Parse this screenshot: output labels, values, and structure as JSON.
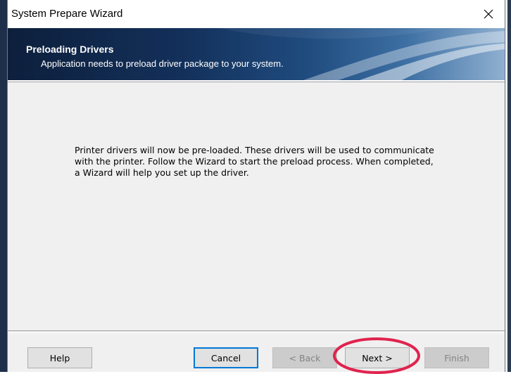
{
  "window": {
    "title": "System Prepare Wizard"
  },
  "banner": {
    "title": "Preloading Drivers",
    "subtitle": "Application needs to preload driver package to your system."
  },
  "content": {
    "message": "Printer drivers will now be pre-loaded. These drivers will be used to communicate with the printer. Follow the Wizard to start the preload process. When completed, a Wizard will help you set up the driver."
  },
  "buttons": {
    "help": "Help",
    "cancel": "Cancel",
    "back": "< Back",
    "next": "Next >",
    "finish": "Finish"
  },
  "colors": {
    "banner_dark": "#0d1f3c",
    "accent": "#0078d7",
    "annotation": "#e0234e"
  },
  "icons": {
    "close": "close-icon"
  }
}
